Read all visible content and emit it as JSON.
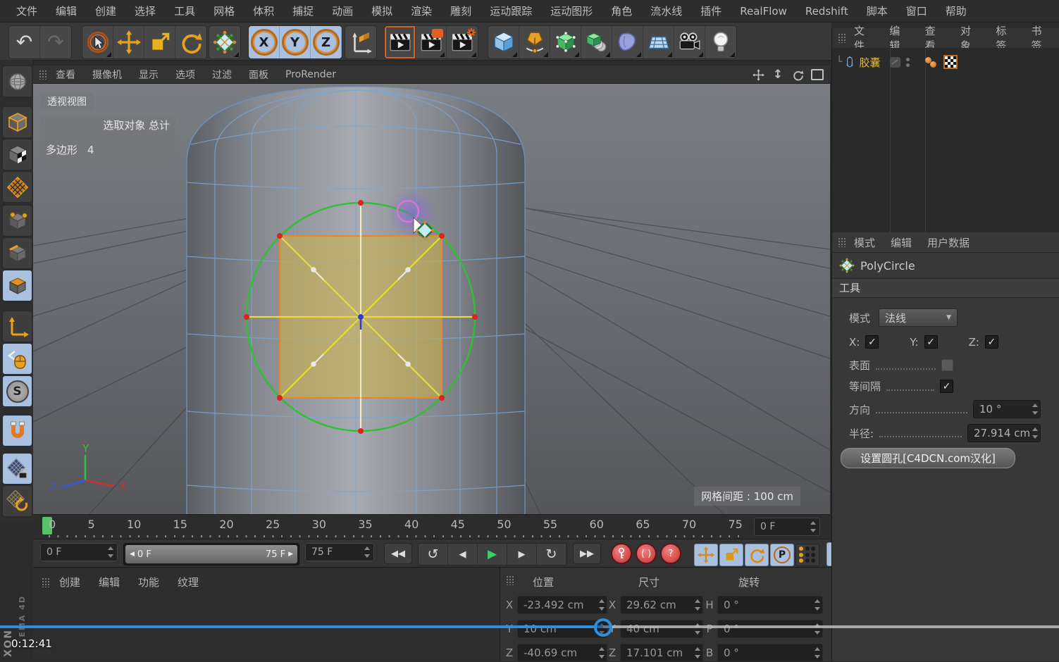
{
  "menubar": {
    "items": [
      "文件",
      "编辑",
      "创建",
      "选择",
      "工具",
      "网格",
      "体积",
      "捕捉",
      "动画",
      "模拟",
      "渲染",
      "雕刻",
      "运动跟踪",
      "运动图形",
      "角色",
      "流水线",
      "插件",
      "RealFlow",
      "Redshift",
      "脚本",
      "窗口",
      "帮助"
    ]
  },
  "toolbar": {
    "axis_locks": [
      "X",
      "Y",
      "Z"
    ]
  },
  "viewport": {
    "menu": [
      "查看",
      "摄像机",
      "显示",
      "选项",
      "过滤",
      "面板",
      "ProRender"
    ],
    "view_label": "透视视图",
    "selection_title": "选取对象 总计",
    "selection_type": "多边形",
    "selection_count": "4",
    "grid_spacing": "网格间距 : 100 cm",
    "axis": {
      "x": "X",
      "y": "Y",
      "z": "Z"
    }
  },
  "timeline": {
    "ticks": [
      "0",
      "5",
      "10",
      "15",
      "20",
      "25",
      "30",
      "35",
      "40",
      "45",
      "50",
      "55",
      "60",
      "65",
      "70",
      "75"
    ],
    "frame_display": "0 F",
    "current": "0 F",
    "range_start": "0 F",
    "range_end": "75 F",
    "end": "75 F"
  },
  "materials": {
    "menu": [
      "创建",
      "编辑",
      "功能",
      "纹理"
    ]
  },
  "watermark": {
    "line1": "XON",
    "line2": "EMA 4D"
  },
  "coordinates": {
    "position": {
      "title": "位置",
      "rows": [
        {
          "axis": "X",
          "value": "-23.492 cm"
        },
        {
          "axis": "Y",
          "value": "10 cm"
        },
        {
          "axis": "Z",
          "value": "-40.69 cm"
        }
      ]
    },
    "size": {
      "title": "尺寸",
      "rows": [
        {
          "axis": "X",
          "value": "29.62 cm"
        },
        {
          "axis": "Y",
          "value": "40 cm"
        },
        {
          "axis": "Z",
          "value": "17.101 cm"
        }
      ]
    },
    "rotation": {
      "title": "旋转",
      "rows": [
        {
          "axis": "H",
          "value": "0 °"
        },
        {
          "axis": "P",
          "value": "0 °"
        },
        {
          "axis": "B",
          "value": "0 °"
        }
      ]
    }
  },
  "object_manager": {
    "menu": [
      "文件",
      "编辑",
      "查看",
      "对象",
      "标签",
      "书签"
    ],
    "object_name": "胶囊"
  },
  "attributes": {
    "menu": [
      "模式",
      "编辑",
      "用户数据"
    ],
    "title": "PolyCircle",
    "section": "工具",
    "mode_label": "模式",
    "mode_value": "法线",
    "x_label": "X:",
    "y_label": "Y:",
    "z_label": "Z:",
    "surface_label": "表面",
    "spacing_label": "等间隔",
    "direction_label": "方向",
    "direction_value": "10 °",
    "radius_label": "半径:",
    "radius_value": "27.914 cm",
    "apply_button": "设置圆孔[C4DCN.com汉化]"
  },
  "player": {
    "timestamp": "0:12:41"
  },
  "icons": {
    "undo": "↶",
    "redo": "↷",
    "check": "✓",
    "dropdown": "▼",
    "prev_key": "↺",
    "next_key": "↻",
    "frame_back": "◀",
    "play": "▶",
    "frame_fwd": "▶",
    "goto_start": "◀◀",
    "goto_end": "▶▶",
    "question": "?",
    "autokey": "( )",
    "p_letter": "P",
    "s_letter": "S",
    "zoom_arrow": "↕",
    "range_left": "◀",
    "range_right": "▶"
  }
}
